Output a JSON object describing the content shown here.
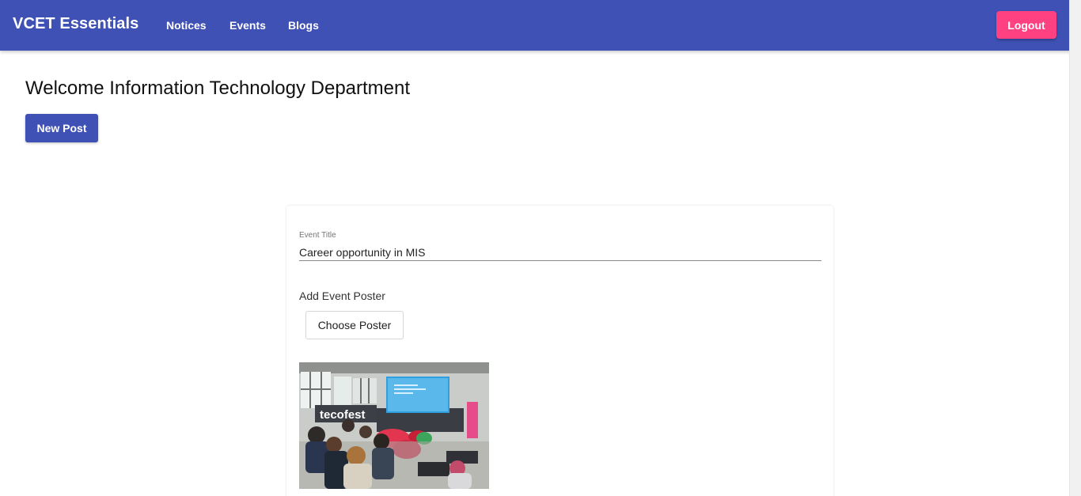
{
  "app": {
    "title": "VCET Essentials"
  },
  "nav": {
    "items": [
      {
        "label": "Notices"
      },
      {
        "label": "Events"
      },
      {
        "label": "Blogs"
      }
    ]
  },
  "header": {
    "logout_label": "Logout"
  },
  "colors": {
    "primary": "#3f51b5",
    "accent": "#ff4081"
  },
  "main": {
    "welcome": "Welcome Information Technology Department",
    "new_post_label": "New Post"
  },
  "form": {
    "event_title_label": "Event Title",
    "event_title_value": "Career opportunity in MIS",
    "add_poster_label": "Add Event Poster",
    "choose_poster_label": "Choose Poster",
    "poster_sign_text": "tecofest"
  }
}
